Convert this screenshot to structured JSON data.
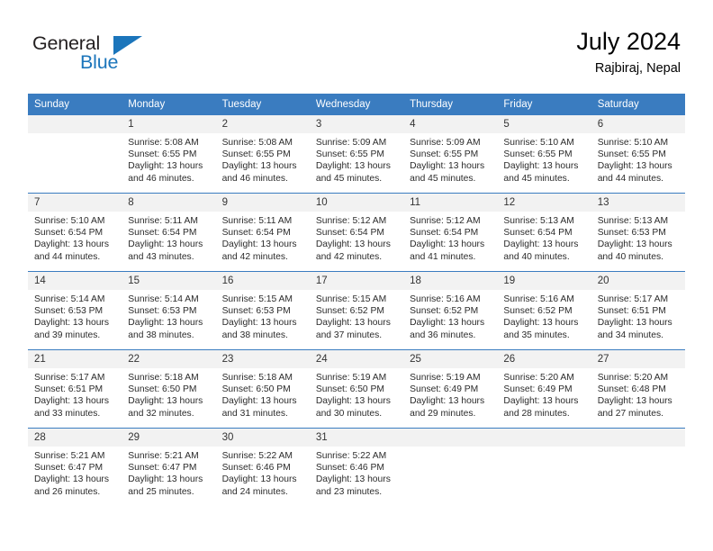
{
  "brand": {
    "name_part1": "General",
    "name_part2": "Blue",
    "triangle_icon": "brand-triangle-icon",
    "accent_color": "#1b75bb"
  },
  "header": {
    "title": "July 2024",
    "subtitle": "Rajbiraj, Nepal",
    "header_bg_color": "#3a7cc0",
    "daynum_bg_color": "#f2f2f2"
  },
  "weekdays": [
    "Sunday",
    "Monday",
    "Tuesday",
    "Wednesday",
    "Thursday",
    "Friday",
    "Saturday"
  ],
  "labels": {
    "sunrise_prefix": "Sunrise:",
    "sunset_prefix": "Sunset:",
    "daylight_prefix": "Daylight:"
  },
  "weeks": [
    [
      {
        "day": "",
        "blank": true
      },
      {
        "day": "1",
        "line1": "Sunrise: 5:08 AM",
        "line2": "Sunset: 6:55 PM",
        "line3": "Daylight: 13 hours",
        "line4": "and 46 minutes."
      },
      {
        "day": "2",
        "line1": "Sunrise: 5:08 AM",
        "line2": "Sunset: 6:55 PM",
        "line3": "Daylight: 13 hours",
        "line4": "and 46 minutes."
      },
      {
        "day": "3",
        "line1": "Sunrise: 5:09 AM",
        "line2": "Sunset: 6:55 PM",
        "line3": "Daylight: 13 hours",
        "line4": "and 45 minutes."
      },
      {
        "day": "4",
        "line1": "Sunrise: 5:09 AM",
        "line2": "Sunset: 6:55 PM",
        "line3": "Daylight: 13 hours",
        "line4": "and 45 minutes."
      },
      {
        "day": "5",
        "line1": "Sunrise: 5:10 AM",
        "line2": "Sunset: 6:55 PM",
        "line3": "Daylight: 13 hours",
        "line4": "and 45 minutes."
      },
      {
        "day": "6",
        "line1": "Sunrise: 5:10 AM",
        "line2": "Sunset: 6:55 PM",
        "line3": "Daylight: 13 hours",
        "line4": "and 44 minutes."
      }
    ],
    [
      {
        "day": "7",
        "line1": "Sunrise: 5:10 AM",
        "line2": "Sunset: 6:54 PM",
        "line3": "Daylight: 13 hours",
        "line4": "and 44 minutes."
      },
      {
        "day": "8",
        "line1": "Sunrise: 5:11 AM",
        "line2": "Sunset: 6:54 PM",
        "line3": "Daylight: 13 hours",
        "line4": "and 43 minutes."
      },
      {
        "day": "9",
        "line1": "Sunrise: 5:11 AM",
        "line2": "Sunset: 6:54 PM",
        "line3": "Daylight: 13 hours",
        "line4": "and 42 minutes."
      },
      {
        "day": "10",
        "line1": "Sunrise: 5:12 AM",
        "line2": "Sunset: 6:54 PM",
        "line3": "Daylight: 13 hours",
        "line4": "and 42 minutes."
      },
      {
        "day": "11",
        "line1": "Sunrise: 5:12 AM",
        "line2": "Sunset: 6:54 PM",
        "line3": "Daylight: 13 hours",
        "line4": "and 41 minutes."
      },
      {
        "day": "12",
        "line1": "Sunrise: 5:13 AM",
        "line2": "Sunset: 6:54 PM",
        "line3": "Daylight: 13 hours",
        "line4": "and 40 minutes."
      },
      {
        "day": "13",
        "line1": "Sunrise: 5:13 AM",
        "line2": "Sunset: 6:53 PM",
        "line3": "Daylight: 13 hours",
        "line4": "and 40 minutes."
      }
    ],
    [
      {
        "day": "14",
        "line1": "Sunrise: 5:14 AM",
        "line2": "Sunset: 6:53 PM",
        "line3": "Daylight: 13 hours",
        "line4": "and 39 minutes."
      },
      {
        "day": "15",
        "line1": "Sunrise: 5:14 AM",
        "line2": "Sunset: 6:53 PM",
        "line3": "Daylight: 13 hours",
        "line4": "and 38 minutes."
      },
      {
        "day": "16",
        "line1": "Sunrise: 5:15 AM",
        "line2": "Sunset: 6:53 PM",
        "line3": "Daylight: 13 hours",
        "line4": "and 38 minutes."
      },
      {
        "day": "17",
        "line1": "Sunrise: 5:15 AM",
        "line2": "Sunset: 6:52 PM",
        "line3": "Daylight: 13 hours",
        "line4": "and 37 minutes."
      },
      {
        "day": "18",
        "line1": "Sunrise: 5:16 AM",
        "line2": "Sunset: 6:52 PM",
        "line3": "Daylight: 13 hours",
        "line4": "and 36 minutes."
      },
      {
        "day": "19",
        "line1": "Sunrise: 5:16 AM",
        "line2": "Sunset: 6:52 PM",
        "line3": "Daylight: 13 hours",
        "line4": "and 35 minutes."
      },
      {
        "day": "20",
        "line1": "Sunrise: 5:17 AM",
        "line2": "Sunset: 6:51 PM",
        "line3": "Daylight: 13 hours",
        "line4": "and 34 minutes."
      }
    ],
    [
      {
        "day": "21",
        "line1": "Sunrise: 5:17 AM",
        "line2": "Sunset: 6:51 PM",
        "line3": "Daylight: 13 hours",
        "line4": "and 33 minutes."
      },
      {
        "day": "22",
        "line1": "Sunrise: 5:18 AM",
        "line2": "Sunset: 6:50 PM",
        "line3": "Daylight: 13 hours",
        "line4": "and 32 minutes."
      },
      {
        "day": "23",
        "line1": "Sunrise: 5:18 AM",
        "line2": "Sunset: 6:50 PM",
        "line3": "Daylight: 13 hours",
        "line4": "and 31 minutes."
      },
      {
        "day": "24",
        "line1": "Sunrise: 5:19 AM",
        "line2": "Sunset: 6:50 PM",
        "line3": "Daylight: 13 hours",
        "line4": "and 30 minutes."
      },
      {
        "day": "25",
        "line1": "Sunrise: 5:19 AM",
        "line2": "Sunset: 6:49 PM",
        "line3": "Daylight: 13 hours",
        "line4": "and 29 minutes."
      },
      {
        "day": "26",
        "line1": "Sunrise: 5:20 AM",
        "line2": "Sunset: 6:49 PM",
        "line3": "Daylight: 13 hours",
        "line4": "and 28 minutes."
      },
      {
        "day": "27",
        "line1": "Sunrise: 5:20 AM",
        "line2": "Sunset: 6:48 PM",
        "line3": "Daylight: 13 hours",
        "line4": "and 27 minutes."
      }
    ],
    [
      {
        "day": "28",
        "line1": "Sunrise: 5:21 AM",
        "line2": "Sunset: 6:47 PM",
        "line3": "Daylight: 13 hours",
        "line4": "and 26 minutes."
      },
      {
        "day": "29",
        "line1": "Sunrise: 5:21 AM",
        "line2": "Sunset: 6:47 PM",
        "line3": "Daylight: 13 hours",
        "line4": "and 25 minutes."
      },
      {
        "day": "30",
        "line1": "Sunrise: 5:22 AM",
        "line2": "Sunset: 6:46 PM",
        "line3": "Daylight: 13 hours",
        "line4": "and 24 minutes."
      },
      {
        "day": "31",
        "line1": "Sunrise: 5:22 AM",
        "line2": "Sunset: 6:46 PM",
        "line3": "Daylight: 13 hours",
        "line4": "and 23 minutes."
      },
      {
        "day": "",
        "blank": true
      },
      {
        "day": "",
        "blank": true
      },
      {
        "day": "",
        "blank": true
      }
    ]
  ]
}
